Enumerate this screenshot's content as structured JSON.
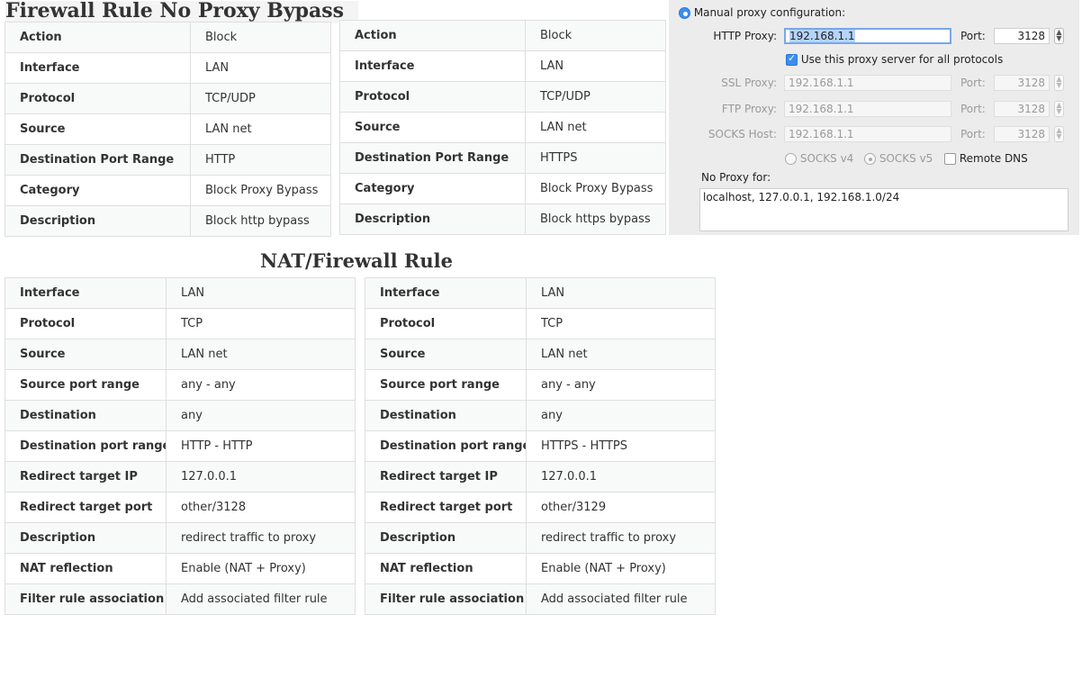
{
  "titles": {
    "bypass": "Firewall Rule No Proxy Bypass",
    "nat": "NAT/Firewall Rule"
  },
  "rule_http": [
    {
      "key": "Action",
      "value": "Block"
    },
    {
      "key": "Interface",
      "value": "LAN"
    },
    {
      "key": "Protocol",
      "value": "TCP/UDP"
    },
    {
      "key": "Source",
      "value": "LAN net"
    },
    {
      "key": "Destination Port Range",
      "value": "HTTP"
    },
    {
      "key": "Category",
      "value": "Block Proxy Bypass"
    },
    {
      "key": "Description",
      "value": "Block http bypass"
    }
  ],
  "rule_https": [
    {
      "key": "Action",
      "value": "Block"
    },
    {
      "key": "Interface",
      "value": "LAN"
    },
    {
      "key": "Protocol",
      "value": "TCP/UDP"
    },
    {
      "key": "Source",
      "value": "LAN net"
    },
    {
      "key": "Destination Port Range",
      "value": "HTTPS"
    },
    {
      "key": "Category",
      "value": "Block Proxy Bypass"
    },
    {
      "key": "Description",
      "value": "Block https bypass"
    }
  ],
  "nat_http": [
    {
      "key": "Interface",
      "value": "LAN"
    },
    {
      "key": "Protocol",
      "value": "TCP"
    },
    {
      "key": "Source",
      "value": "LAN net"
    },
    {
      "key": "Source port range",
      "value": "any - any"
    },
    {
      "key": "Destination",
      "value": "any"
    },
    {
      "key": "Destination port range",
      "value": "HTTP - HTTP"
    },
    {
      "key": "Redirect target IP",
      "value": "127.0.0.1"
    },
    {
      "key": "Redirect target port",
      "value": "other/3128"
    },
    {
      "key": "Description",
      "value": "redirect traffic to proxy"
    },
    {
      "key": "NAT reflection",
      "value": "Enable (NAT + Proxy)"
    },
    {
      "key": "Filter rule association",
      "value": "Add associated filter rule"
    }
  ],
  "nat_https": [
    {
      "key": "Interface",
      "value": "LAN"
    },
    {
      "key": "Protocol",
      "value": "TCP"
    },
    {
      "key": "Source",
      "value": "LAN net"
    },
    {
      "key": "Source port range",
      "value": "any - any"
    },
    {
      "key": "Destination",
      "value": "any"
    },
    {
      "key": "Destination port range",
      "value": "HTTPS - HTTPS"
    },
    {
      "key": "Redirect target IP",
      "value": "127.0.0.1"
    },
    {
      "key": "Redirect target port",
      "value": "other/3129"
    },
    {
      "key": "Description",
      "value": "redirect traffic to proxy"
    },
    {
      "key": "NAT reflection",
      "value": "Enable (NAT + Proxy)"
    },
    {
      "key": "Filter rule association",
      "value": "Add associated filter rule"
    }
  ],
  "proxy": {
    "manual_label": "Manual proxy configuration:",
    "http_label": "HTTP Proxy:",
    "http_value": "192.168.1.1",
    "port_label": "Port:",
    "http_port": "3128",
    "use_all_label": "Use this proxy server for all protocols",
    "ssl_label": "SSL Proxy:",
    "ssl_value": "192.168.1.1",
    "ssl_port": "3128",
    "ftp_label": "FTP Proxy:",
    "ftp_value": "192.168.1.1",
    "ftp_port": "3128",
    "socks_label": "SOCKS Host:",
    "socks_value": "192.168.1.1",
    "socks_port": "3128",
    "socks_v4": "SOCKS v4",
    "socks_v5": "SOCKS v5",
    "remote_dns": "Remote DNS",
    "no_proxy_label": "No Proxy for:",
    "no_proxy_value": "localhost, 127.0.0.1, 192.168.1.0/24"
  }
}
